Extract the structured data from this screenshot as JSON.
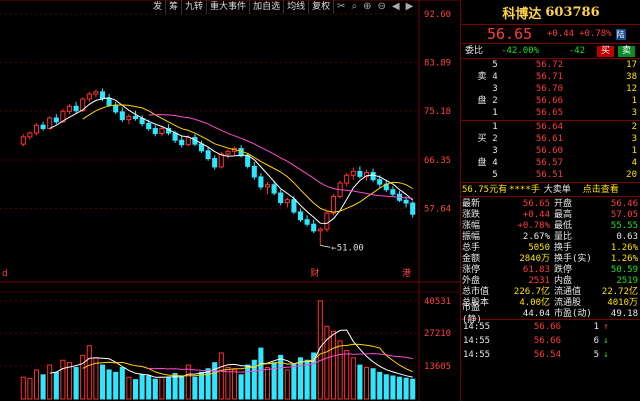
{
  "toolbar": {
    "items": [
      "发",
      "筹",
      "九转",
      "重大事件",
      "加自选",
      "均线",
      "复权"
    ],
    "icons": [
      "scissors-icon",
      "search-icon",
      "magnify-plus-icon",
      "magnify-minus-icon",
      "left-arrow-icon",
      "right-arrow-icon"
    ]
  },
  "chart": {
    "price_ticks": [
      "92.60",
      "83.89",
      "75.18",
      "66.35",
      "57.64"
    ],
    "volume_ticks": [
      "40531",
      "27210",
      "13605"
    ],
    "low_marker": "51.00",
    "bottom_marks": {
      "left": "d",
      "mid": "财",
      "right": "港"
    },
    "ma_colors": [
      "#ffffff",
      "#ffd200",
      "#ff4ad0"
    ]
  },
  "chart_data": {
    "type": "candlestick",
    "ylim": [
      48,
      92.6
    ],
    "candles": [
      [
        69.2,
        71.0,
        68.8,
        70.5
      ],
      [
        70.5,
        71.5,
        70.0,
        71.2
      ],
      [
        71.2,
        73.0,
        70.8,
        72.6
      ],
      [
        72.6,
        73.2,
        71.6,
        72.0
      ],
      [
        72.0,
        74.2,
        71.8,
        73.9
      ],
      [
        73.9,
        74.6,
        72.8,
        73.2
      ],
      [
        73.2,
        75.6,
        73.0,
        75.1
      ],
      [
        75.1,
        76.4,
        74.6,
        76.0
      ],
      [
        76.0,
        76.8,
        74.8,
        75.2
      ],
      [
        75.2,
        77.6,
        75.0,
        77.3
      ],
      [
        77.3,
        78.6,
        76.8,
        78.2
      ],
      [
        78.2,
        79.0,
        77.6,
        78.6
      ],
      [
        78.6,
        79.2,
        76.9,
        77.4
      ],
      [
        77.4,
        78.2,
        75.9,
        76.2
      ],
      [
        76.2,
        76.8,
        74.6,
        75.0
      ],
      [
        75.0,
        75.8,
        73.2,
        73.6
      ],
      [
        73.6,
        74.6,
        72.8,
        74.2
      ],
      [
        74.2,
        75.2,
        73.4,
        73.8
      ],
      [
        73.8,
        74.4,
        72.4,
        72.9
      ],
      [
        72.9,
        73.6,
        71.6,
        72.0
      ],
      [
        72.0,
        72.6,
        70.6,
        71.1
      ],
      [
        71.1,
        72.4,
        70.6,
        72.0
      ],
      [
        72.0,
        72.8,
        70.8,
        71.2
      ],
      [
        71.2,
        71.6,
        69.4,
        69.9
      ],
      [
        69.9,
        70.6,
        68.6,
        69.1
      ],
      [
        69.1,
        70.8,
        68.8,
        70.4
      ],
      [
        70.4,
        71.0,
        68.8,
        69.2
      ],
      [
        69.2,
        69.8,
        67.6,
        68.0
      ],
      [
        68.0,
        68.6,
        66.2,
        66.6
      ],
      [
        66.6,
        67.2,
        64.6,
        65.1
      ],
      [
        65.1,
        67.8,
        64.8,
        67.4
      ],
      [
        67.4,
        68.2,
        66.6,
        67.9
      ],
      [
        67.9,
        68.8,
        67.2,
        68.4
      ],
      [
        68.4,
        69.0,
        66.8,
        67.1
      ],
      [
        67.1,
        67.6,
        64.8,
        65.2
      ],
      [
        65.2,
        66.0,
        62.8,
        63.3
      ],
      [
        63.3,
        64.0,
        61.0,
        61.5
      ],
      [
        61.5,
        62.4,
        60.2,
        61.9
      ],
      [
        61.9,
        62.6,
        60.0,
        60.4
      ],
      [
        60.4,
        61.0,
        58.2,
        58.7
      ],
      [
        58.7,
        59.6,
        57.8,
        59.2
      ],
      [
        59.2,
        59.8,
        56.6,
        57.0
      ],
      [
        57.0,
        57.6,
        55.2,
        55.6
      ],
      [
        55.6,
        56.4,
        54.4,
        54.8
      ],
      [
        54.8,
        55.6,
        53.2,
        53.6
      ],
      [
        53.6,
        54.2,
        51.0,
        53.9
      ],
      [
        53.9,
        57.2,
        53.4,
        56.8
      ],
      [
        56.8,
        60.2,
        56.4,
        59.8
      ],
      [
        59.8,
        62.6,
        59.4,
        62.2
      ],
      [
        62.2,
        64.0,
        61.6,
        63.6
      ],
      [
        63.6,
        65.0,
        62.8,
        64.3
      ],
      [
        64.3,
        65.2,
        63.0,
        63.4
      ],
      [
        63.4,
        64.6,
        62.6,
        64.1
      ],
      [
        64.1,
        64.8,
        62.4,
        62.8
      ],
      [
        62.8,
        63.6,
        61.4,
        62.0
      ],
      [
        62.0,
        62.8,
        60.6,
        61.0
      ],
      [
        61.0,
        61.6,
        59.8,
        60.2
      ],
      [
        60.2,
        60.8,
        58.8,
        59.1
      ],
      [
        59.1,
        59.8,
        57.8,
        58.6
      ],
      [
        58.6,
        58.9,
        56.0,
        56.6
      ]
    ],
    "volume": [
      9000,
      8500,
      12000,
      10000,
      14000,
      11000,
      16000,
      15000,
      13000,
      18000,
      22000,
      17000,
      14000,
      12000,
      11000,
      13000,
      9000,
      8000,
      10000,
      9500,
      8200,
      9000,
      8800,
      10500,
      9200,
      14000,
      9000,
      11000,
      12500,
      15000,
      19000,
      13000,
      12000,
      10000,
      14000,
      16000,
      21000,
      13000,
      15000,
      18000,
      12000,
      14500,
      17000,
      16000,
      19000,
      40531,
      30000,
      28000,
      24000,
      20000,
      17000,
      14000,
      13000,
      12500,
      11000,
      10000,
      9500,
      9000,
      8600,
      8200
    ]
  },
  "panel": {
    "stock_name": "科博达",
    "stock_code": "603786",
    "price": "56.65",
    "change": "+0.44",
    "change_pct": "+0.78%",
    "badge": "陆",
    "weibi": {
      "label": "委比",
      "pct": "-42.00%",
      "diff": "-42",
      "buy": "买",
      "sell": "卖"
    },
    "sell_orders": [
      {
        "level": "5",
        "price": "56.72",
        "vol": "17"
      },
      {
        "level": "4",
        "price": "56.71",
        "vol": "38"
      },
      {
        "level": "3",
        "price": "56.70",
        "vol": "12"
      },
      {
        "level": "2",
        "price": "56.66",
        "vol": "1"
      },
      {
        "level": "1",
        "price": "56.65",
        "vol": "3"
      }
    ],
    "sell_side": "卖盘",
    "buy_orders": [
      {
        "level": "1",
        "price": "56.64",
        "vol": "2"
      },
      {
        "level": "2",
        "price": "56.61",
        "vol": "3"
      },
      {
        "level": "3",
        "price": "56.60",
        "vol": "1"
      },
      {
        "level": "4",
        "price": "56.57",
        "vol": "4"
      },
      {
        "level": "5",
        "price": "56.51",
        "vol": "20"
      }
    ],
    "buy_side": "买盘",
    "promo": {
      "price": "56.75元有",
      "stars": "****手",
      "tag": "大卖单",
      "link": "点击查看"
    },
    "stats": [
      {
        "l1": "最新",
        "v1": "56.65",
        "c1": "red",
        "l2": "开盘",
        "v2": "56.46",
        "c2": "red"
      },
      {
        "l1": "涨跌",
        "v1": "+0.44",
        "c1": "red",
        "l2": "最高",
        "v2": "57.05",
        "c2": "red"
      },
      {
        "l1": "涨幅",
        "v1": "+0.78%",
        "c1": "red",
        "l2": "最低",
        "v2": "55.55",
        "c2": "green"
      },
      {
        "l1": "振幅",
        "v1": "2.67%",
        "c1": "white",
        "l2": "量比",
        "v2": "0.63",
        "c2": "white"
      },
      {
        "l1": "总手",
        "v1": "5050",
        "c1": "yellow",
        "l2": "换手",
        "v2": "1.26%",
        "c2": "yellow"
      },
      {
        "l1": "金额",
        "v1": "2840万",
        "c1": "yellow",
        "l2": "换手(实)",
        "v2": "1.26%",
        "c2": "yellow"
      },
      {
        "l1": "涨停",
        "v1": "61.83",
        "c1": "red",
        "l2": "跌停",
        "v2": "50.59",
        "c2": "green"
      },
      {
        "l1": "外盘",
        "v1": "2531",
        "c1": "red",
        "l2": "内盘",
        "v2": "2519",
        "c2": "green"
      },
      {
        "l1": "总市值",
        "v1": "226.7亿",
        "c1": "yellow",
        "l2": "流通值",
        "v2": "22.72亿",
        "c2": "yellow"
      },
      {
        "l1": "总股本",
        "v1": "4.00亿",
        "c1": "yellow",
        "l2": "流通股",
        "v2": "4010万",
        "c2": "yellow"
      },
      {
        "l1": "市盈(静)",
        "v1": "44.04",
        "c1": "white",
        "l2": "市盈(动)",
        "v2": "49.18",
        "c2": "white"
      }
    ],
    "ticks": [
      {
        "time": "14:55",
        "price": "56.66",
        "vol": "1",
        "arrow": "↑",
        "dir": "up"
      },
      {
        "time": "14:55",
        "price": "56.66",
        "vol": "6",
        "arrow": "↓",
        "dir": "down"
      },
      {
        "time": "14:55",
        "price": "56.54",
        "vol": "5",
        "arrow": "↓",
        "dir": "down"
      }
    ]
  }
}
